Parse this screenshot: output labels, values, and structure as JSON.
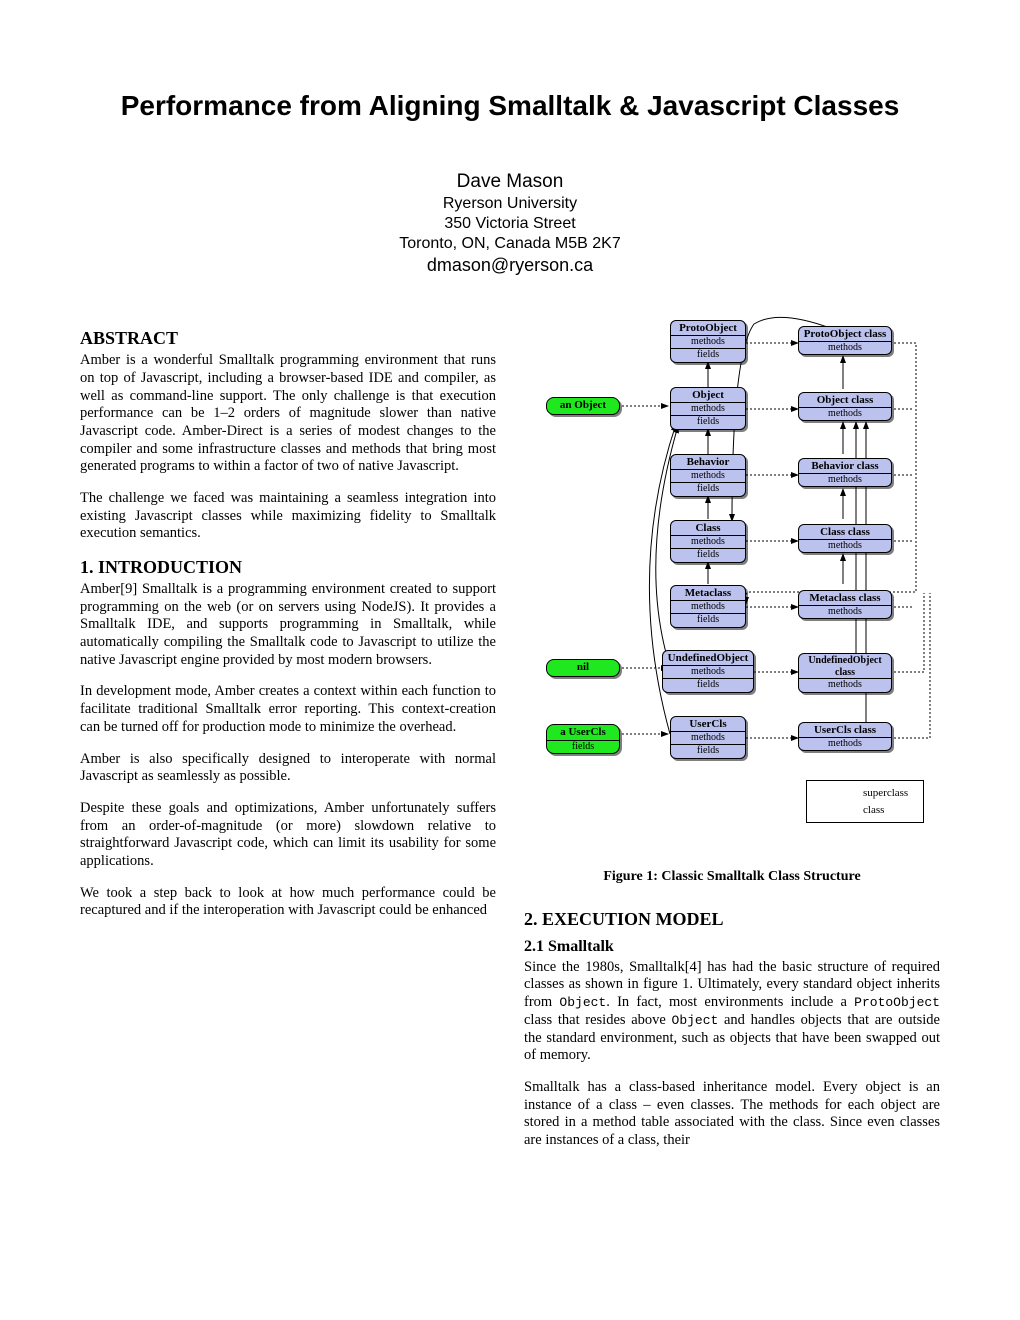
{
  "title": "Performance from Aligning Smalltalk & Javascript Classes",
  "author": {
    "name": "Dave Mason",
    "affil": "Ryerson University",
    "addr1": "350 Victoria Street",
    "addr2": "Toronto, ON, Canada   M5B 2K7",
    "email": "dmason@ryerson.ca"
  },
  "left": {
    "abstract_h": "ABSTRACT",
    "abstract_p1": "Amber is a wonderful Smalltalk programming environment that runs on top of Javascript, including a browser-based IDE and compiler, as well as command-line support. The only challenge is that execution performance can be 1–2 orders of magnitude slower than native Javascript code. Amber-Direct is a series of modest changes to the compiler and some infrastructure classes and methods that bring most generated programs to within a factor of two of native Javascript.",
    "abstract_p2": "The challenge we faced was maintaining a seamless integration into existing Javascript classes while maximizing fidelity to Smalltalk execution semantics.",
    "intro_h": "1.    INTRODUCTION",
    "intro_p1": "Amber[9] Smalltalk is a programming environment created to support programming on the web (or on servers using NodeJS). It provides a Smalltalk IDE, and supports programming in Smalltalk, while automatically compiling the Smalltalk code to Javascript to utilize the native Javascript engine provided by most modern browsers.",
    "intro_p2": "In development mode, Amber creates a context within each function to facilitate traditional Smalltalk error reporting. This context-creation can be turned off for production mode to minimize the overhead.",
    "intro_p3": "Amber is also specifically designed to interoperate with normal Javascript as seamlessly as possible.",
    "intro_p4": "Despite these goals and optimizations, Amber unfortunately suffers from an order-of-magnitude (or more) slowdown relative to straightforward Javascript code, which can limit its usability for some applications.",
    "intro_p5": "We took a step back to look at how much performance could be recaptured and if the interoperation with Javascript could be enhanced"
  },
  "right": {
    "fig_caption": "Figure 1: Classic Smalltalk Class Structure",
    "exec_h": "2.    EXECUTION MODEL",
    "sub_h": "2.1    Smalltalk",
    "p1a": "Since the 1980s, Smalltalk[4] has had the basic structure of required classes as shown in figure 1. Ultimately, every standard object inherits from ",
    "p1_obj": "Object",
    "p1b": ". In fact, most environments include a ",
    "p1_proto": "ProtoObject",
    "p1c": " class that resides above ",
    "p1_obj2": "Object",
    "p1d": " and handles objects that are outside the standard environment, such as objects that have been swapped out of memory.",
    "p2": "Smalltalk has a class-based inheritance model. Every object is an instance of a class – even classes. The methods for each object are stored in a method table associated with the class. Since even classes are instances of a class, their"
  },
  "diagram": {
    "instances": {
      "anObject": "an Object",
      "nil": "nil",
      "aUserCls": "a UserCls",
      "fields": "fields"
    },
    "classesL": [
      "ProtoObject",
      "Object",
      "Behavior",
      "Class",
      "Metaclass",
      "UndefinedObject",
      "UserCls"
    ],
    "classesR": [
      "ProtoObject class",
      "Object class",
      "Behavior class",
      "Class class",
      "Metaclass class",
      "UndefinedObject class",
      "UserCls class"
    ],
    "row_methods": "methods",
    "row_fields": "fields",
    "legend": {
      "superclass": "superclass",
      "class": "class"
    }
  }
}
